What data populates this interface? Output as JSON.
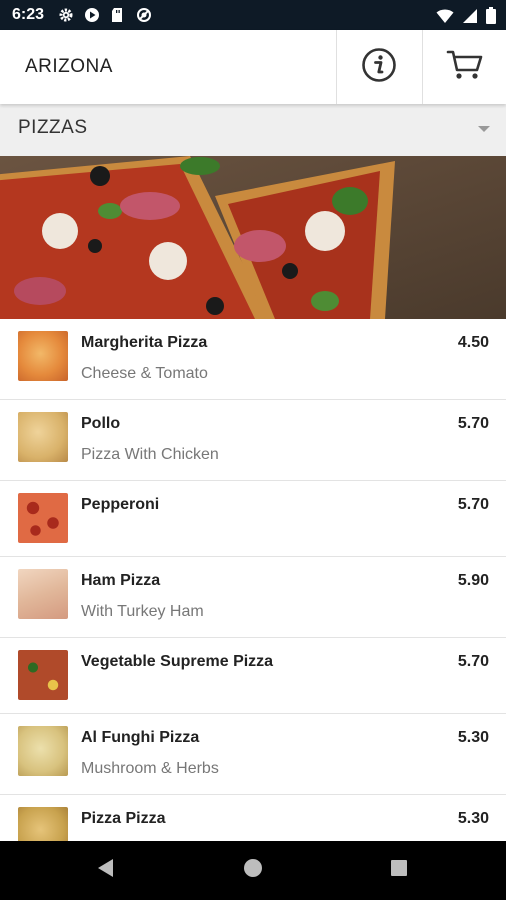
{
  "status_bar": {
    "time": "6:23",
    "left_icons": [
      "gear-icon",
      "play-protect-icon",
      "sd-card-icon",
      "blocked-icon"
    ],
    "right_icons": [
      "wifi-icon",
      "signal-icon",
      "battery-icon"
    ]
  },
  "app_bar": {
    "title": "ARIZONA",
    "info_icon": "info-icon",
    "cart_icon": "cart-icon"
  },
  "category": {
    "label": "PIZZAS",
    "dropdown_icon": "caret-down-icon"
  },
  "hero": {
    "image": "pizza-slices-banner"
  },
  "menu": {
    "items": [
      {
        "name": "Margherita Pizza",
        "desc": "Cheese & Tomato",
        "price": "4.50",
        "thumb_color": "#e58a3c"
      },
      {
        "name": "Pollo",
        "desc": "Pizza With Chicken",
        "price": "5.70",
        "thumb_color": "#d9b26a"
      },
      {
        "name": "Pepperoni",
        "desc": "",
        "price": "5.70",
        "thumb_color": "#c8482e"
      },
      {
        "name": "Ham Pizza",
        "desc": "With Turkey Ham",
        "price": "5.90",
        "thumb_color": "#e1b79a"
      },
      {
        "name": "Vegetable Supreme Pizza",
        "desc": "",
        "price": "5.70",
        "thumb_color": "#b04a2a"
      },
      {
        "name": "Al Funghi Pizza",
        "desc": "Mushroom & Herbs",
        "price": "5.30",
        "thumb_color": "#d8c27e"
      },
      {
        "name": "Pizza Pizza",
        "desc": "",
        "price": "5.30",
        "thumb_color": "#c8a24e"
      }
    ]
  },
  "nav_bar": {
    "back_icon": "back-icon",
    "home_icon": "home-icon",
    "recents_icon": "recents-icon"
  }
}
